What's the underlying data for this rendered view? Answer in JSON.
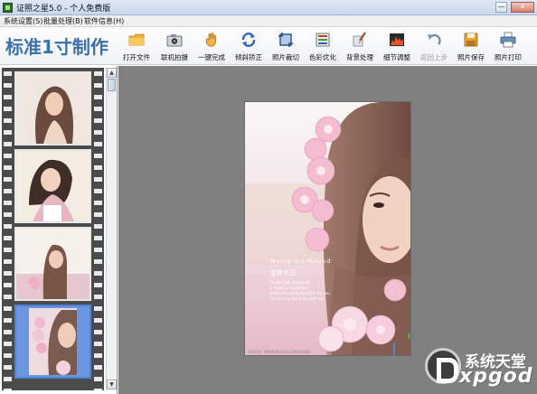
{
  "window": {
    "title": "证照之星5.0 - 个人免费版",
    "minimize_glyph": "—",
    "close_glyph": "✕"
  },
  "menu": {
    "items": [
      "系统设置(S)",
      "批量处理(B)",
      "软件信息(H)"
    ]
  },
  "toolbar": {
    "brand": "标准1寸制作",
    "tools": [
      {
        "label": "打开文件",
        "icon": "folder-icon",
        "enabled": true
      },
      {
        "label": "联机拍摄",
        "icon": "camera-icon",
        "enabled": true
      },
      {
        "label": "一键完成",
        "icon": "hand-icon",
        "enabled": true
      },
      {
        "label": "倾斜矫正",
        "icon": "rotate-icon",
        "enabled": true
      },
      {
        "label": "照片裁切",
        "icon": "crop-icon",
        "enabled": true
      },
      {
        "label": "色彩优化",
        "icon": "color-icon",
        "enabled": true
      },
      {
        "label": "背景处理",
        "icon": "brush-icon",
        "enabled": true
      },
      {
        "label": "细节调整",
        "icon": "levels-icon",
        "enabled": true
      },
      {
        "label": "返回上步",
        "icon": "undo-icon",
        "enabled": false
      },
      {
        "label": "照片保存",
        "icon": "save-icon",
        "enabled": true
      },
      {
        "label": "照片打印",
        "icon": "printer-icon",
        "enabled": true
      }
    ]
  },
  "filmstrip": {
    "selected_index": 3,
    "thumbnail_count": 4
  },
  "photo": {
    "title_line": "Merry-Go-Round",
    "subtitle": "旋转木马",
    "body_lines": [
      "Tonight will always be",
      "a night to remember",
      "Make this world beautiful for you",
      "You're only one to be with me"
    ],
    "caption": "PHOTO: WWW.PHOTO.COM/XXXXX"
  },
  "watermark": {
    "cn": "系统天堂",
    "en": "xpgod"
  },
  "colors": {
    "brand_blue": "#3a6fb0",
    "canvas_gray": "#808080",
    "selected_thumb": "#6b97e0"
  }
}
